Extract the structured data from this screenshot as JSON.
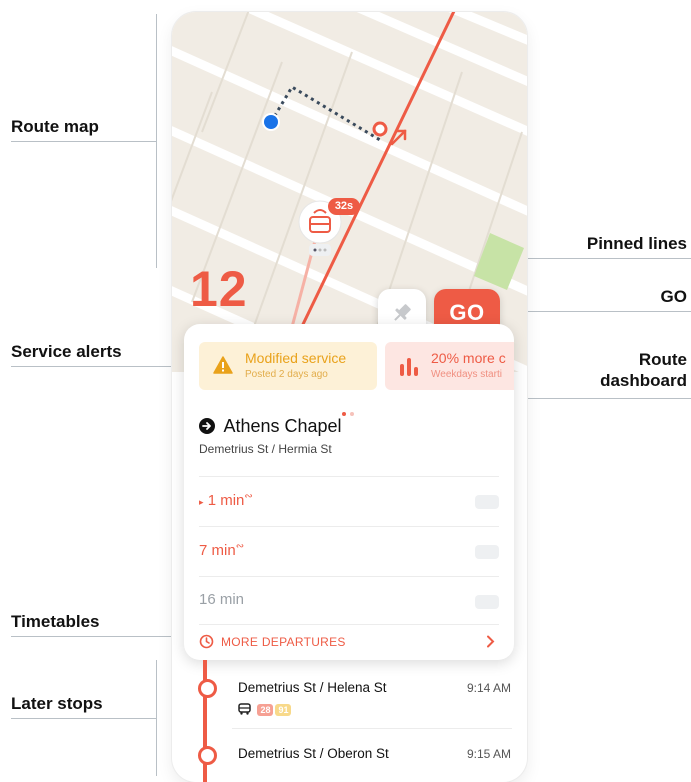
{
  "annotations": {
    "route_map": "Route map",
    "service_alerts": "Service alerts",
    "timetables": "Timetables",
    "later_stops": "Later stops",
    "pinned_lines": "Pinned lines",
    "go": "GO",
    "route_dashboard_line1": "Route",
    "route_dashboard_line2": "dashboard"
  },
  "map": {
    "route_number": "12",
    "vehicle_eta": "32s",
    "pin_icon": "pin-icon",
    "go_label": "GO"
  },
  "alerts": [
    {
      "title": "Modified service",
      "subtitle": "Posted 2 days ago",
      "icon": "warning-icon",
      "color": "#e9a21b"
    },
    {
      "title": "20% more c",
      "subtitle": "Weekdays starti",
      "icon": "bar-chart-icon",
      "color": "#ee5b45"
    }
  ],
  "departure": {
    "destination": "Athens Chapel",
    "stop": "Demetrius St / Hermia St",
    "times": [
      {
        "label": "1 min",
        "realtime": true,
        "state": "next"
      },
      {
        "label": "7 min",
        "realtime": true,
        "state": "upcoming"
      },
      {
        "label": "16 min",
        "realtime": false,
        "state": "scheduled"
      }
    ],
    "more_label": "MORE DEPARTURES"
  },
  "later_stops": [
    {
      "name": "Demetrius St / Helena St",
      "time": "9:14 AM",
      "chips": [
        "28",
        "91"
      ]
    },
    {
      "name": "Demetrius St / Oberon St",
      "time": "9:15 AM",
      "chips": []
    }
  ],
  "colors": {
    "accent": "#ee5b45",
    "warning": "#e9a21b",
    "map_bg": "#f1ece4",
    "park": "#c7e3a6",
    "user_location": "#1a73e8"
  }
}
